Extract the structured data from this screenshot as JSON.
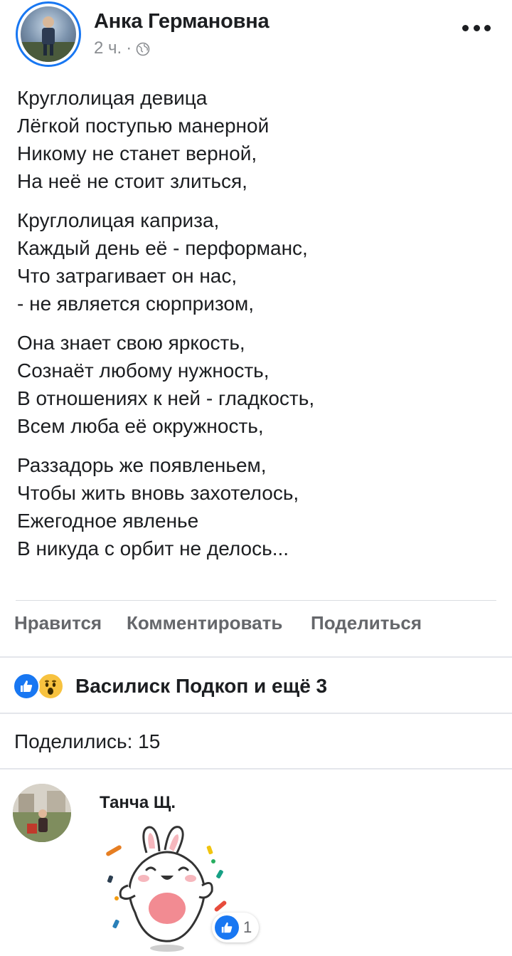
{
  "post": {
    "author": "Анка Германовна",
    "time": "2 ч.",
    "meta_separator": "·",
    "stanzas": [
      [
        "Круглолицая девица",
        "Лёгкой поступью манерной",
        "Никому не станет верной,",
        "На неё не стоит злиться,"
      ],
      [
        "Круглолицая каприза,",
        "Каждый день её - перформанс,",
        "Что затрагивает он нас,",
        "- не является сюрпризом,"
      ],
      [
        "Она знает свою яркость,",
        "Сознаёт любому нужность,",
        "В отношениях к ней - гладкость,",
        "Всем люба её окружность,"
      ],
      [
        "Раззадорь же появленьем,",
        "Чтобы жить вновь захотелось,",
        "Ежегодное явленье",
        "В никуда с орбит не делось..."
      ]
    ]
  },
  "actions": {
    "like": "Нравится",
    "comment": "Комментировать",
    "share": "Поделиться"
  },
  "reactions": {
    "icons": [
      "like-icon",
      "wow-icon"
    ],
    "summary": "Василиск Подкоп и ещё 3"
  },
  "shares": {
    "text": "Поделились: 15"
  },
  "comment": {
    "author": "Танча Щ.",
    "sticker": "bunny-sticker",
    "like_count": "1"
  },
  "colors": {
    "accent": "#1877f2",
    "text": "#1c1e21",
    "secondary": "#65676b",
    "meta": "#8a8d91",
    "divider": "#e4e6eb"
  }
}
